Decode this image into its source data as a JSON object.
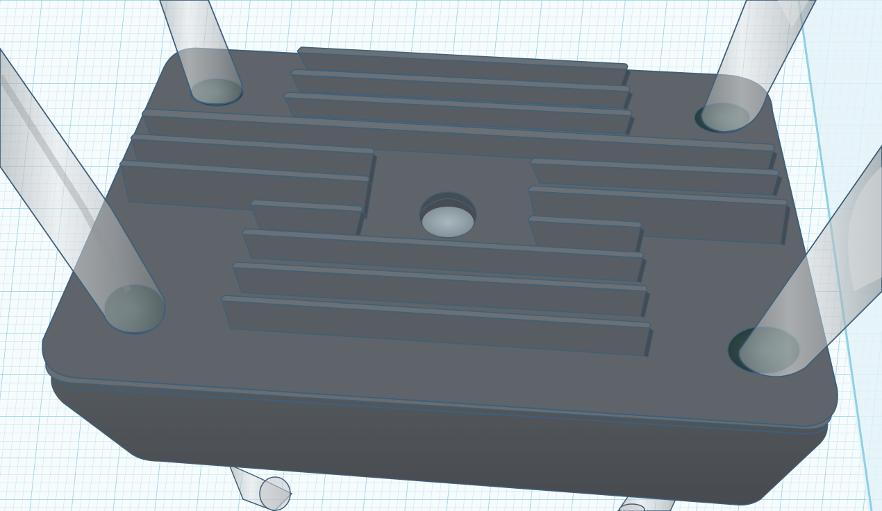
{
  "app": {
    "view": "3d-workplane",
    "labels_visible": false
  },
  "colors": {
    "workplane_background": "#f6fbfd",
    "grid_minor": "#bfe3ef",
    "grid_major": "#7cc7df",
    "plate_top": "#5e6469",
    "plate_side": "#4d5256",
    "plate_edge": "#6b7177",
    "fin_face": "#575d62",
    "fin_top": "#6a7075",
    "outline": "#3f5f7a",
    "hole_fill": "#c8d4da",
    "rod_glass": "#cfd3d6",
    "rod_dark": "#3a3d40",
    "rod_teal": "#2f4a4a"
  },
  "scene": {
    "objects": [
      {
        "kind": "plate",
        "name": "base-plate"
      },
      {
        "kind": "fin-group",
        "name": "top-fins",
        "count": 3
      },
      {
        "kind": "fin-group",
        "name": "left-fins",
        "count": 3
      },
      {
        "kind": "fin-group",
        "name": "right-fins",
        "count": 3
      },
      {
        "kind": "fin-group",
        "name": "center-fins",
        "count": 4
      },
      {
        "kind": "hole",
        "name": "center-hole"
      },
      {
        "kind": "corner-hole",
        "name": "corner-hole",
        "count": 4
      },
      {
        "kind": "transparent-rod",
        "name": "support-rod",
        "count": 6
      }
    ]
  }
}
